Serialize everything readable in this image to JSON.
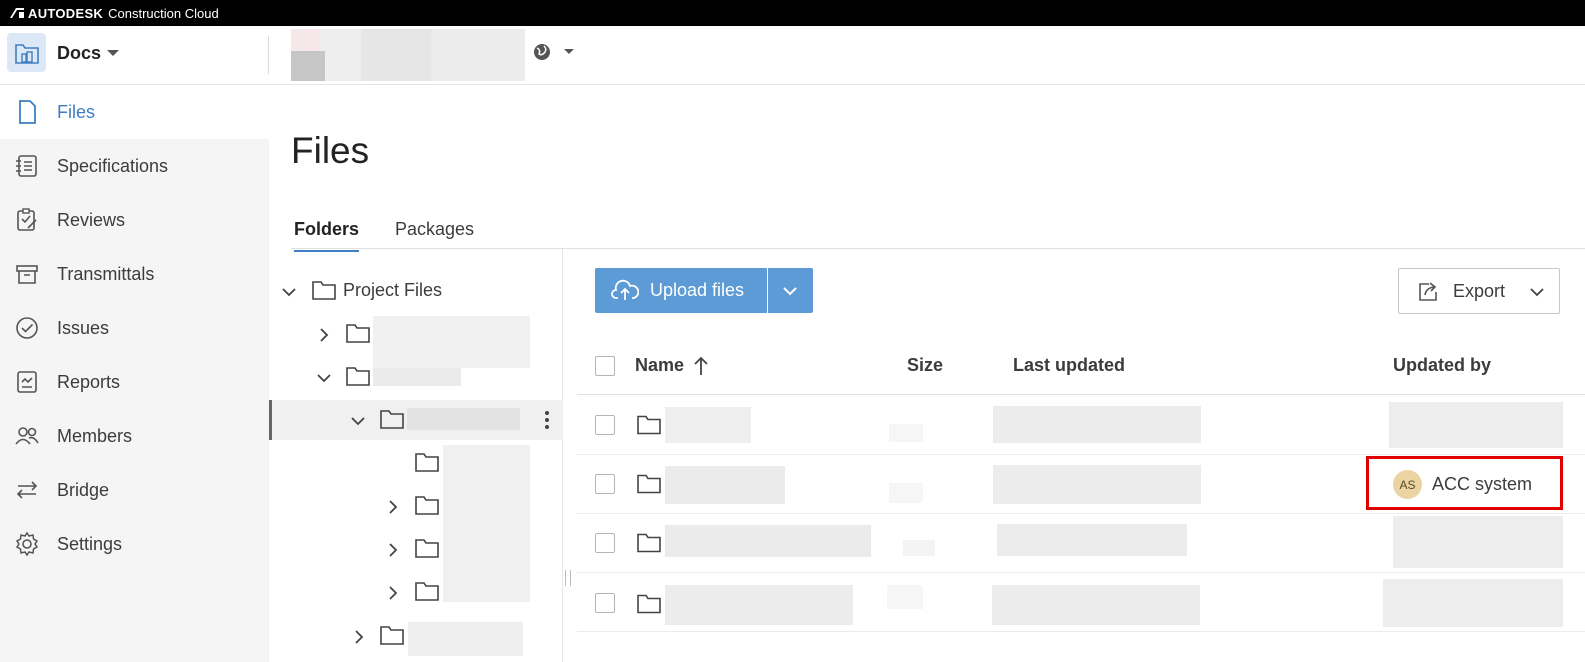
{
  "topbar": {
    "brand_bold": "AUTODESK",
    "brand_rest": "Construction Cloud"
  },
  "header": {
    "module_name": "Docs"
  },
  "sidebar": {
    "items": [
      {
        "label": "Files",
        "icon": "file-icon",
        "active": true
      },
      {
        "label": "Specifications",
        "icon": "specifications-icon"
      },
      {
        "label": "Reviews",
        "icon": "reviews-icon"
      },
      {
        "label": "Transmittals",
        "icon": "transmittals-icon"
      },
      {
        "label": "Issues",
        "icon": "issues-icon"
      },
      {
        "label": "Reports",
        "icon": "reports-icon"
      },
      {
        "label": "Members",
        "icon": "members-icon"
      },
      {
        "label": "Bridge",
        "icon": "bridge-icon"
      },
      {
        "label": "Settings",
        "icon": "settings-icon"
      }
    ]
  },
  "main": {
    "title": "Files",
    "tabs": [
      {
        "label": "Folders",
        "active": true
      },
      {
        "label": "Packages"
      }
    ]
  },
  "tree": {
    "root_label": "Project Files"
  },
  "toolbar": {
    "upload_label": "Upload files",
    "export_label": "Export"
  },
  "table": {
    "columns": {
      "name": "Name",
      "size": "Size",
      "last_updated": "Last updated",
      "updated_by": "Updated by"
    },
    "highlighted_row": {
      "avatar_initials": "AS",
      "updated_by": "ACC system"
    }
  },
  "colors": {
    "accent": "#3e7fc1",
    "primary_button": "#5d9bd7",
    "highlight": "#e00000"
  }
}
